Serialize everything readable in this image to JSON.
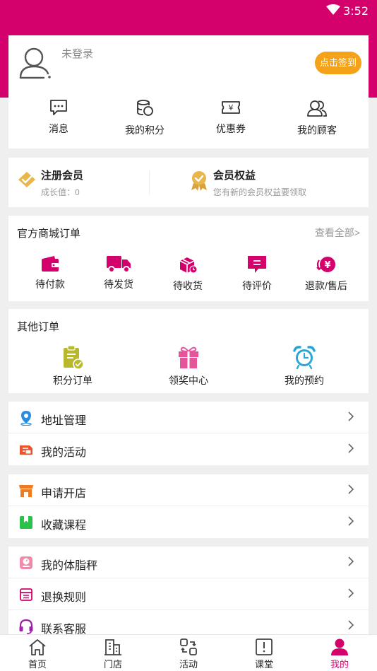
{
  "status_bar": {
    "time": "3:52"
  },
  "profile": {
    "login_status": "未登录",
    "signin_button": "点击签到"
  },
  "quick_links": [
    {
      "label": "消息",
      "icon": "message-icon"
    },
    {
      "label": "我的积分",
      "icon": "points-icon"
    },
    {
      "label": "优惠券",
      "icon": "coupon-icon"
    },
    {
      "label": "我的顾客",
      "icon": "customers-icon"
    }
  ],
  "member": {
    "register_title": "注册会员",
    "growth_text": "成长值：0",
    "benefits_title": "会员权益",
    "benefits_sub": "您有新的会员权益要领取"
  },
  "mall_orders": {
    "title": "官方商城订单",
    "view_all": "查看全部>",
    "items": [
      {
        "label": "待付款",
        "icon": "wallet-icon"
      },
      {
        "label": "待发货",
        "icon": "truck-icon"
      },
      {
        "label": "待收货",
        "icon": "package-icon"
      },
      {
        "label": "待评价",
        "icon": "comment-icon"
      },
      {
        "label": "退款/售后",
        "icon": "refund-icon"
      }
    ]
  },
  "other_orders": {
    "title": "其他订单",
    "items": [
      {
        "label": "积分订单",
        "icon": "clipboard-check-icon"
      },
      {
        "label": "领奖中心",
        "icon": "gift-icon"
      },
      {
        "label": "我的预约",
        "icon": "alarm-clock-icon"
      }
    ]
  },
  "menu_groups": [
    [
      {
        "label": "地址管理",
        "icon": "location-pin-icon"
      },
      {
        "label": "我的活动",
        "icon": "activity-ticket-icon"
      }
    ],
    [
      {
        "label": "申请开店",
        "icon": "store-icon"
      },
      {
        "label": "收藏课程",
        "icon": "bookmark-icon"
      }
    ],
    [
      {
        "label": "我的体脂秤",
        "icon": "scale-icon"
      },
      {
        "label": "退换规则",
        "icon": "rules-box-icon"
      },
      {
        "label": "联系客服",
        "icon": "headset-icon"
      }
    ]
  ],
  "tabs": [
    {
      "label": "首页",
      "icon": "home-icon"
    },
    {
      "label": "门店",
      "icon": "building-icon"
    },
    {
      "label": "活动",
      "icon": "swap-icon"
    },
    {
      "label": "课堂",
      "icon": "book-alert-icon"
    },
    {
      "label": "我的",
      "icon": "user-icon",
      "active": true
    }
  ],
  "colors": {
    "brand": "#d4006c",
    "signin": "#f3a21a",
    "gold": "#e8b64a"
  }
}
